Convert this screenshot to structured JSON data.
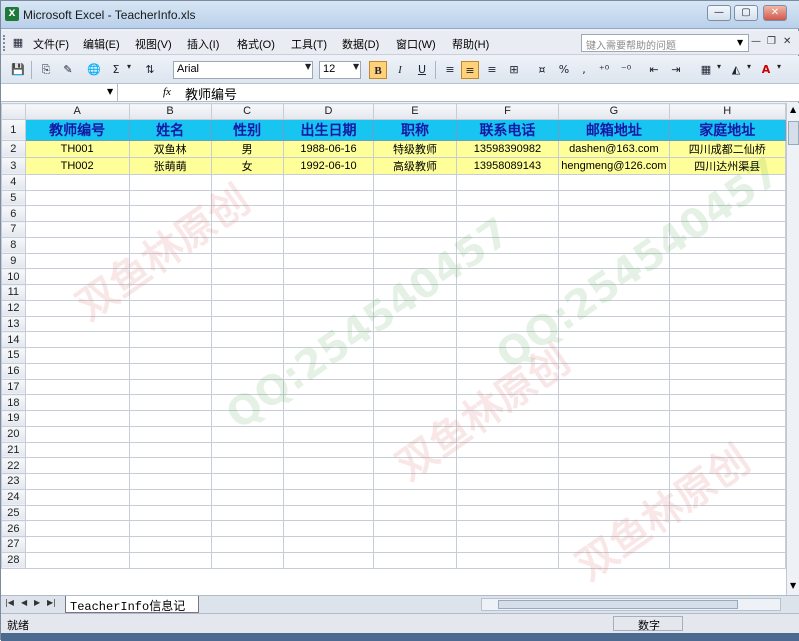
{
  "window": {
    "title": "Microsoft Excel - TeacherInfo.xls"
  },
  "menu": [
    "文件(F)",
    "编辑(E)",
    "视图(V)",
    "插入(I)",
    "格式(O)",
    "工具(T)",
    "数据(D)",
    "窗口(W)",
    "帮助(H)"
  ],
  "help_placeholder": "键入需要帮助的问题",
  "toolbar": {
    "font_name": "Arial",
    "font_size": "12",
    "bold": "B",
    "italic": "I",
    "underline": "U",
    "percent": "%",
    "comma": ",",
    "sigma": "Σ"
  },
  "formula_bar": {
    "name_box": "",
    "fx": "fx",
    "content": "教师编号"
  },
  "sheet": {
    "columns": [
      "A",
      "B",
      "C",
      "D",
      "E",
      "F",
      "G",
      "H"
    ],
    "header": [
      "教师编号",
      "姓名",
      "性别",
      "出生日期",
      "职称",
      "联系电话",
      "邮箱地址",
      "家庭地址"
    ],
    "rows": [
      [
        "TH001",
        "双鱼林",
        "男",
        "1988-06-16",
        "特级教师",
        "13598390982",
        "dashen@163.com",
        "四川成都二仙桥"
      ],
      [
        "TH002",
        "张萌萌",
        "女",
        "1992-06-10",
        "高级教师",
        "13958089143",
        "hengmeng@126.com",
        "四川达州渠县"
      ]
    ],
    "row_count": 28
  },
  "tab": {
    "name": "TeacherInfo信息记录"
  },
  "status": {
    "ready": "就绪",
    "num": "数字"
  },
  "watermarks": [
    "双鱼林原创",
    "QQ:254540457",
    "双鱼林原创",
    "QQ:254540457",
    "双鱼林原创"
  ]
}
